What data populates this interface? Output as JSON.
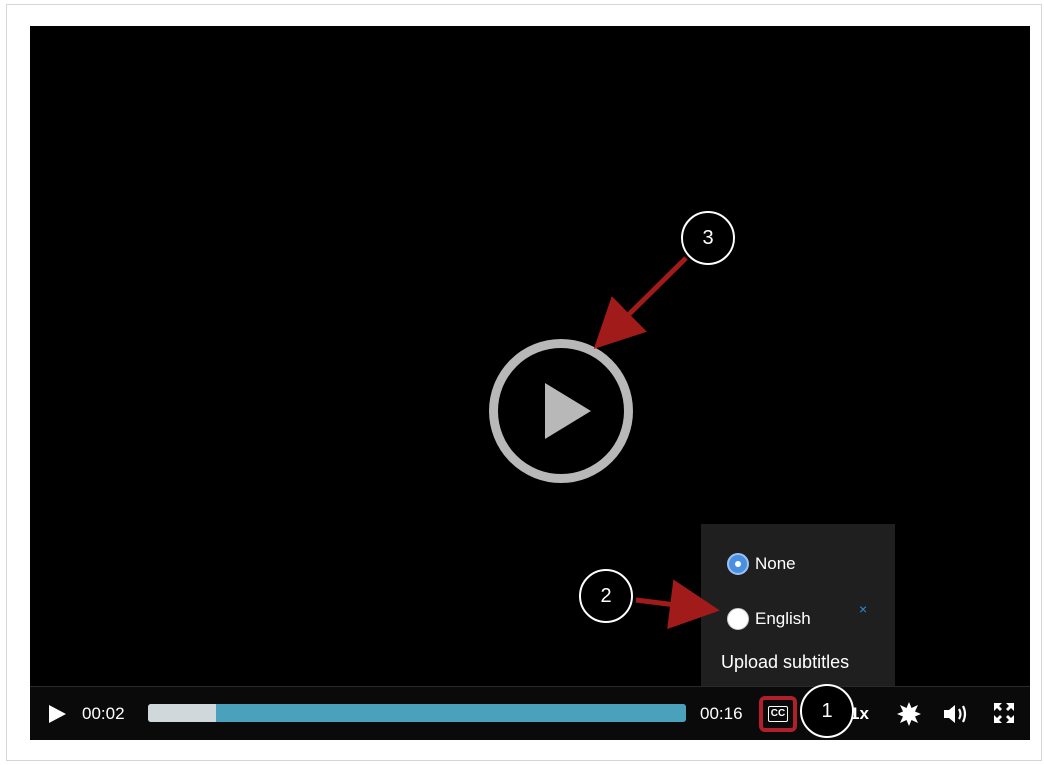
{
  "player": {
    "current_time": "00:02",
    "duration": "00:16",
    "progress_fraction": 0.127,
    "speed_label": "1x"
  },
  "subtitles_menu": {
    "options": [
      {
        "label": "None",
        "selected": true
      },
      {
        "label": "English",
        "selected": false
      }
    ],
    "remove_label": "×",
    "upload_label": "Upload subtitles"
  },
  "callouts": [
    "1",
    "2",
    "3"
  ],
  "icons": {
    "play": "play-icon",
    "big_play": "big-play-icon",
    "cc": "closed-captions-icon",
    "settings": "gear-icon",
    "volume": "volume-icon",
    "fullscreen": "fullscreen-icon"
  },
  "colors": {
    "progress_track": "#3b8aa3",
    "progress_played": "#d0d8dc",
    "highlight_border": "#b0202a",
    "annotation_arrow": "#a11b1b",
    "radio_selected": "#4a90e2"
  }
}
